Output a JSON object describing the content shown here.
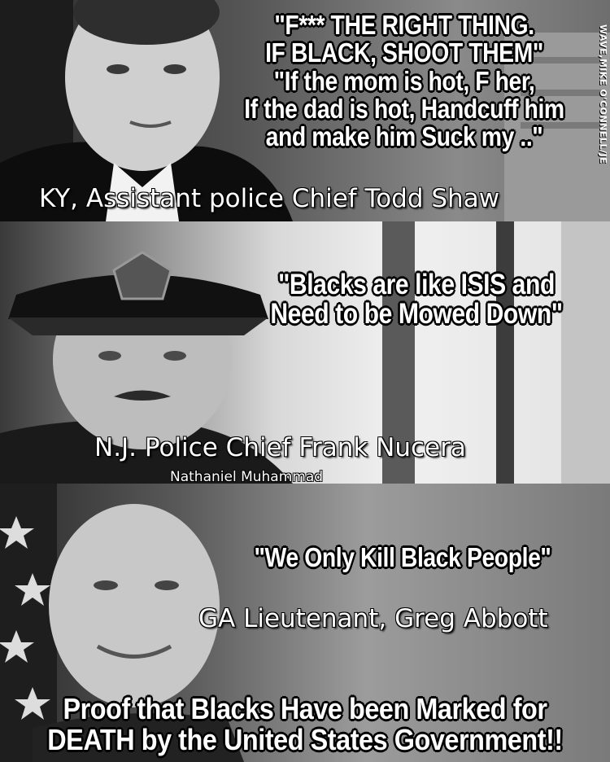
{
  "panels": [
    {
      "quote_lines": [
        "\"F*** THE RIGHT THING.",
        "IF BLACK, SHOOT THEM\"",
        "\"If the mom is hot, F her,",
        "If the dad is hot, Handcuff him",
        "and make him Suck my ..\""
      ],
      "caption": "KY, Assistant police Chief Todd Shaw"
    },
    {
      "quote_lines": [
        "\"Blacks are like ISIS and",
        "Need to be Mowed Down\""
      ],
      "caption": "N.J. Police Chief Frank Nucera",
      "credit": "Nathaniel Muhammad"
    },
    {
      "quote_lines": [
        "\"We Only Kill Black People\""
      ],
      "caption": "GA Lieutenant, Greg Abbott"
    }
  ],
  "tagline_lines": [
    "Proof that Blacks Have been Marked for",
    "DEATH by the United States Government!!"
  ],
  "watermark": "WAVE,MIKE O'CONNELL/JE",
  "colors": {
    "text": "#ffffff",
    "outline": "#000000"
  }
}
